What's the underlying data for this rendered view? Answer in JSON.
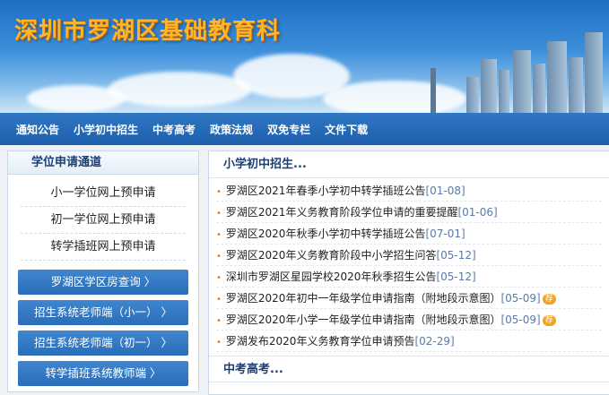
{
  "banner": {
    "title": "深圳市罗湖区基础教育科"
  },
  "nav": [
    "通知公告",
    "小学初中招生",
    "中考高考",
    "政策法规",
    "双免专栏",
    "文件下载"
  ],
  "left": {
    "title": "学位申请通道",
    "links": [
      "小一学位网上预申请",
      "初一学位网上预申请",
      "转学插班网上预申请"
    ],
    "buttons": [
      "罗湖区学区房查询 〉",
      "招生系统老师端（小一） 〉",
      "招生系统老师端（初一） 〉",
      "转学插班系统教师端 〉"
    ]
  },
  "right": {
    "section1": {
      "title": "小学初中招生...",
      "items": [
        {
          "text": "罗湖区2021年春季小学初中转学插班公告",
          "date": "[01-08]",
          "hot": false
        },
        {
          "text": "罗湖区2021年义务教育阶段学位申请的重要提醒",
          "date": "[01-06]",
          "hot": false
        },
        {
          "text": "罗湖区2020年秋季小学初中转学插班公告",
          "date": "[07-01]",
          "hot": false
        },
        {
          "text": "罗湖区2020年义务教育阶段中小学招生问答",
          "date": "[05-12]",
          "hot": false
        },
        {
          "text": "深圳市罗湖区星园学校2020年秋季招生公告",
          "date": "[05-12]",
          "hot": false
        },
        {
          "text": "罗湖区2020年初中一年级学位申请指南（附地段示意图）",
          "date": "[05-09]",
          "hot": true
        },
        {
          "text": "罗湖区2020年小学一年级学位申请指南（附地段示意图）",
          "date": "[05-09]",
          "hot": true
        },
        {
          "text": "罗湖发布2020年义务教育学位申请预告",
          "date": "[02-29]",
          "hot": false
        }
      ]
    },
    "section2": {
      "title": "中考高考..."
    },
    "hot_label": "荐"
  }
}
